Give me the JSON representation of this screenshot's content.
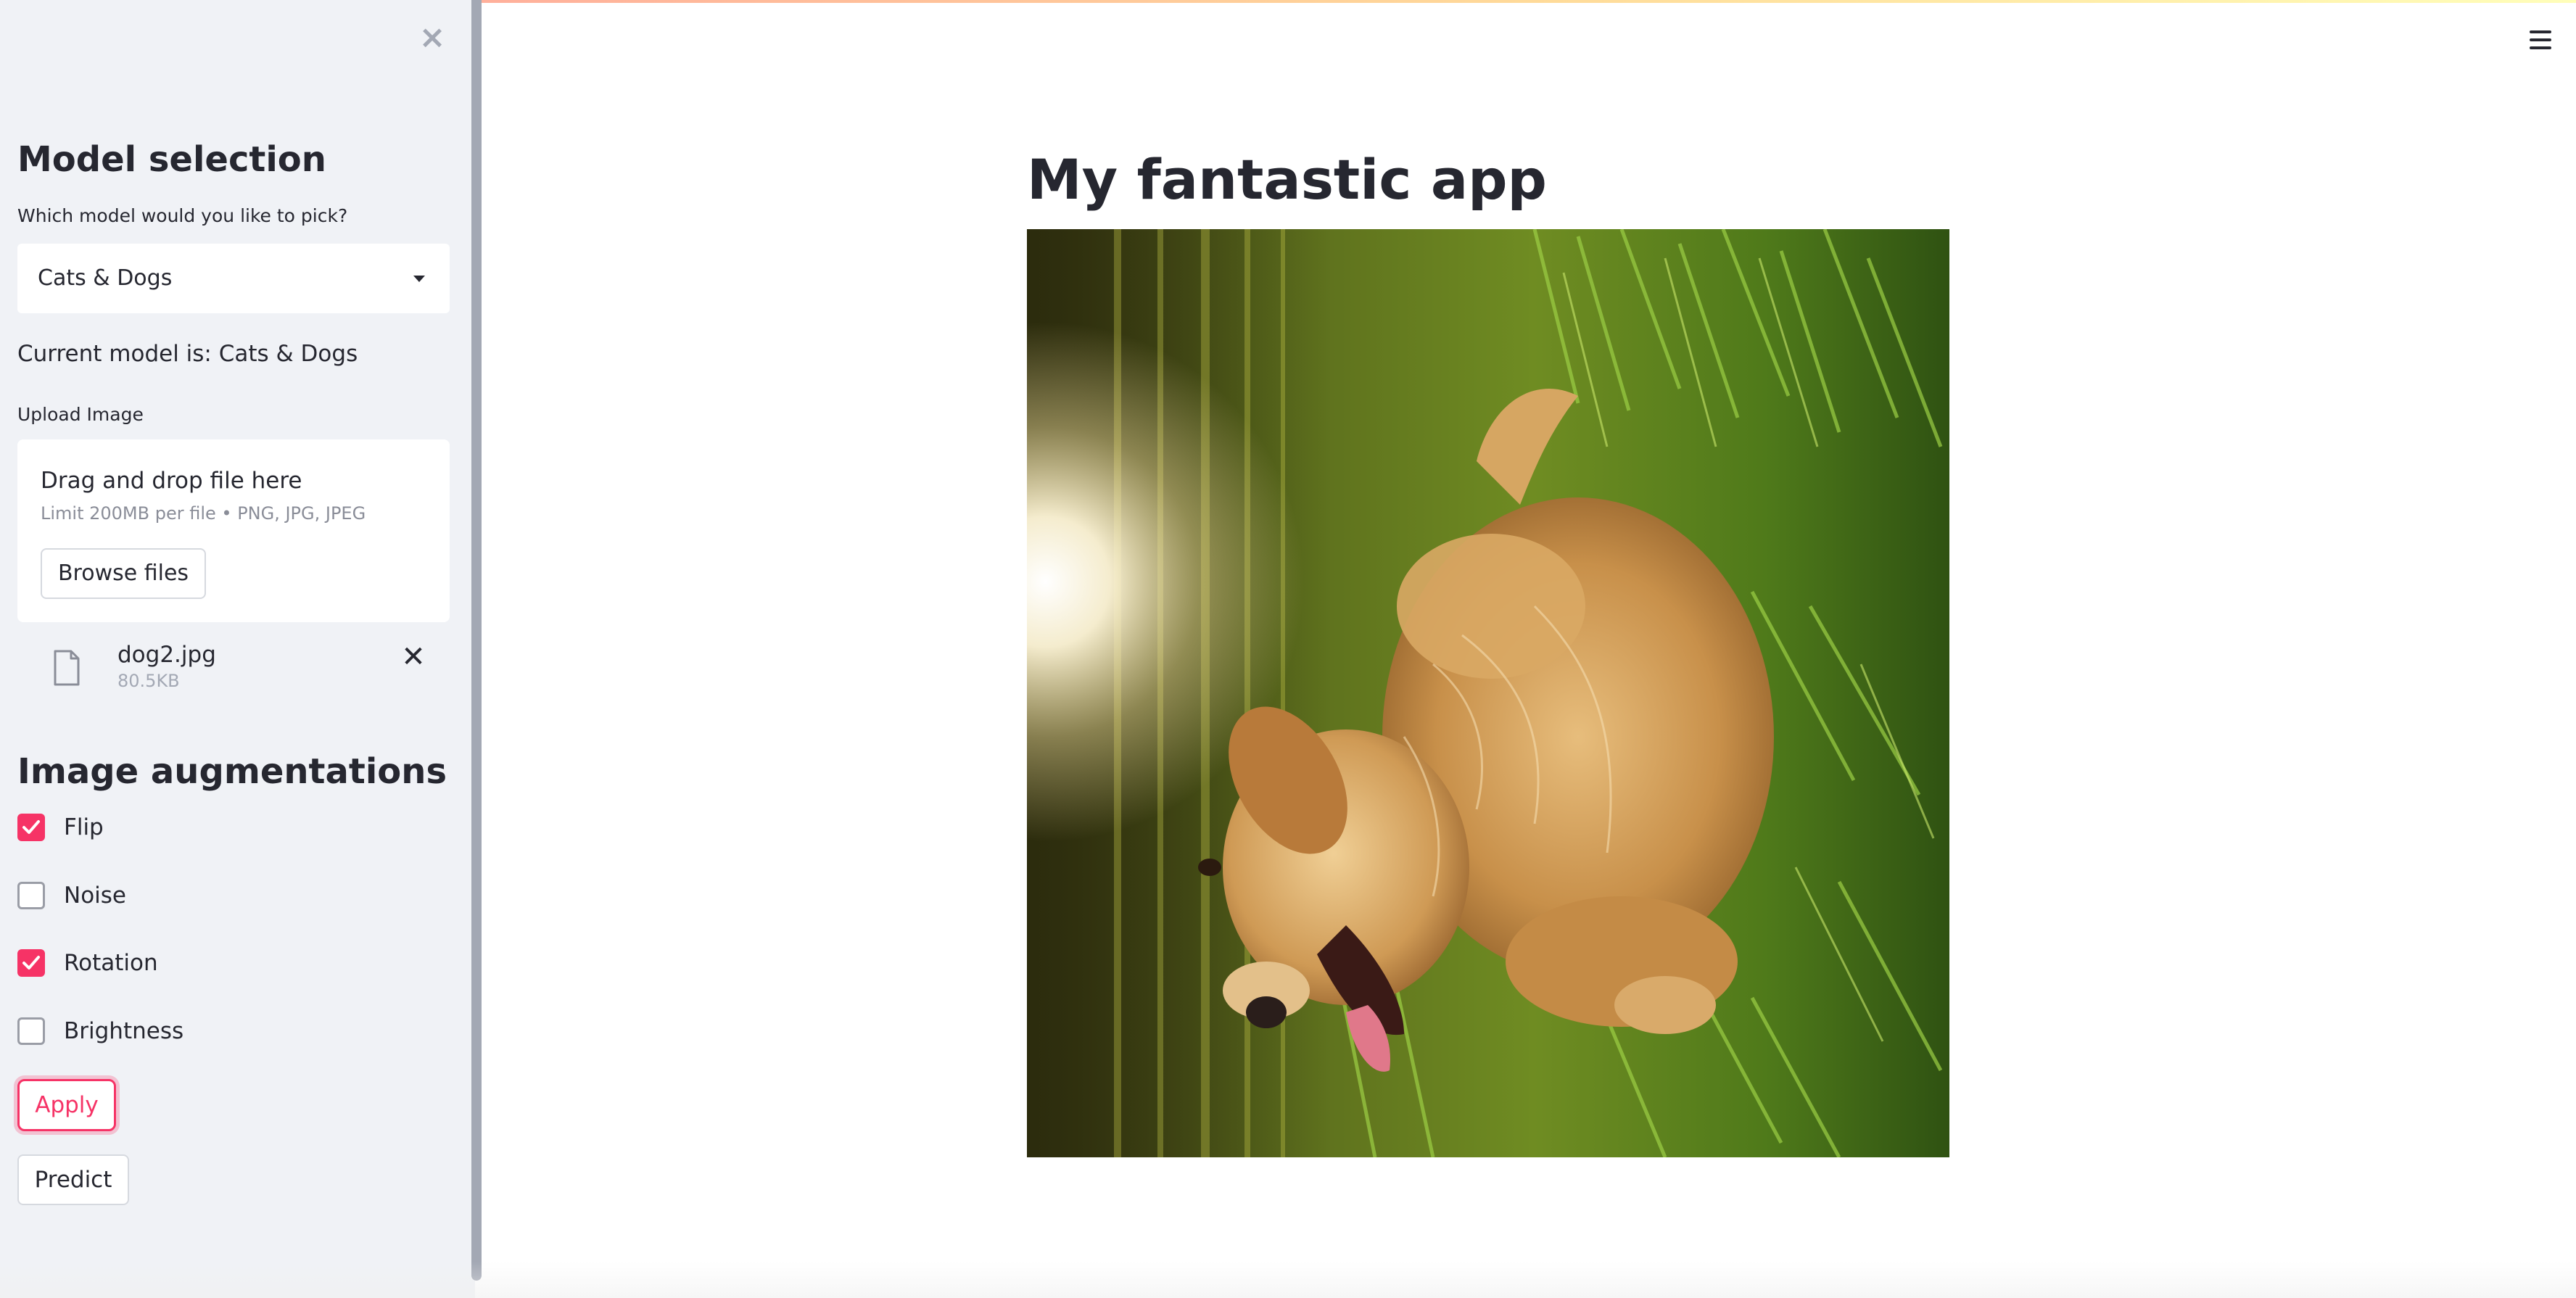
{
  "sidebar": {
    "model_heading": "Model selection",
    "model_question": "Which model would you like to pick?",
    "model_select_value": "Cats & Dogs",
    "current_model_text": "Current model is: Cats & Dogs",
    "upload_label": "Upload Image",
    "uploader": {
      "drag_text": "Drag and drop file here",
      "limit_text": "Limit 200MB per file • PNG, JPG, JPEG",
      "browse_label": "Browse files"
    },
    "file": {
      "name": "dog2.jpg",
      "size": "80.5KB"
    },
    "augment_heading": "Image augmentations",
    "augmentations": [
      {
        "label": "Flip",
        "checked": true
      },
      {
        "label": "Noise",
        "checked": false
      },
      {
        "label": "Rotation",
        "checked": true
      },
      {
        "label": "Brightness",
        "checked": false
      }
    ],
    "apply_label": "Apply",
    "predict_label": "Predict",
    "close_icon": "close-icon"
  },
  "main": {
    "title": "My fantastic app",
    "image": "golden-retriever-rotated-photo"
  },
  "header": {
    "menu_icon": "hamburger-menu-icon"
  },
  "colors": {
    "accent": "#f63366",
    "sidebar_bg": "#f0f2f6",
    "text": "#262730"
  }
}
